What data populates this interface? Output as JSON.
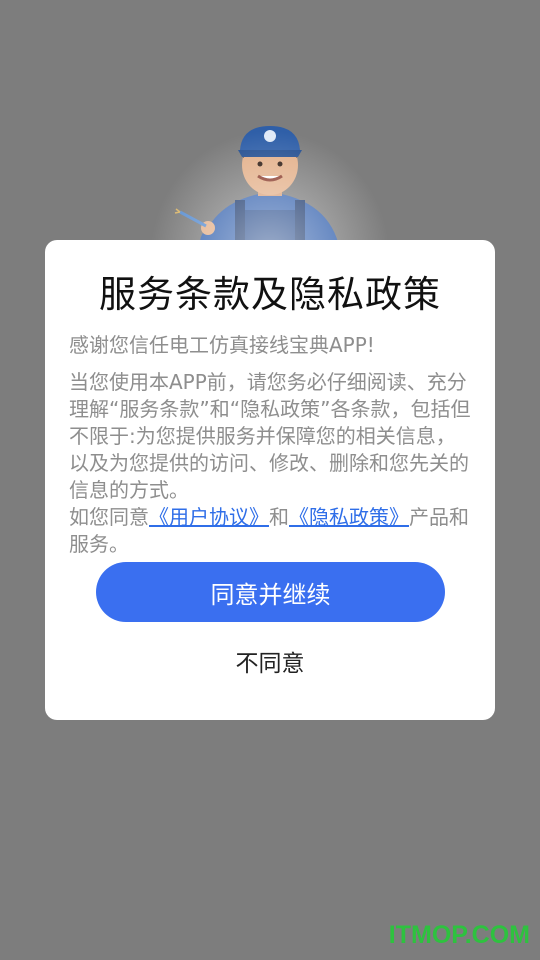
{
  "dialog": {
    "title": "服务条款及隐私政策",
    "intro": "感谢您信任电工仿真接线宝典APP!",
    "body": "当您使用本APP前，请您务必仔细阅读、充分理解“服务条款”和“隐私政策”各条款，包括但不限于:为您提供服务并保障您的相关信息，以及为您提供的访问、修改、删除和您先关的信息的方式。",
    "consent_prefix": "如您同意",
    "user_agreement_link": "《用户协议》",
    "consent_and": "和",
    "privacy_policy_link": "《隐私政策》",
    "consent_suffix_visible": "产品和服务。",
    "agree_button": "同意并继续",
    "disagree_button": "不同意"
  },
  "watermark": "ITMOP.COM",
  "colors": {
    "overlay": "#7d7d7d",
    "accent": "#3a6ff0",
    "link": "#2f6ee8",
    "watermark": "#2ec23f"
  }
}
